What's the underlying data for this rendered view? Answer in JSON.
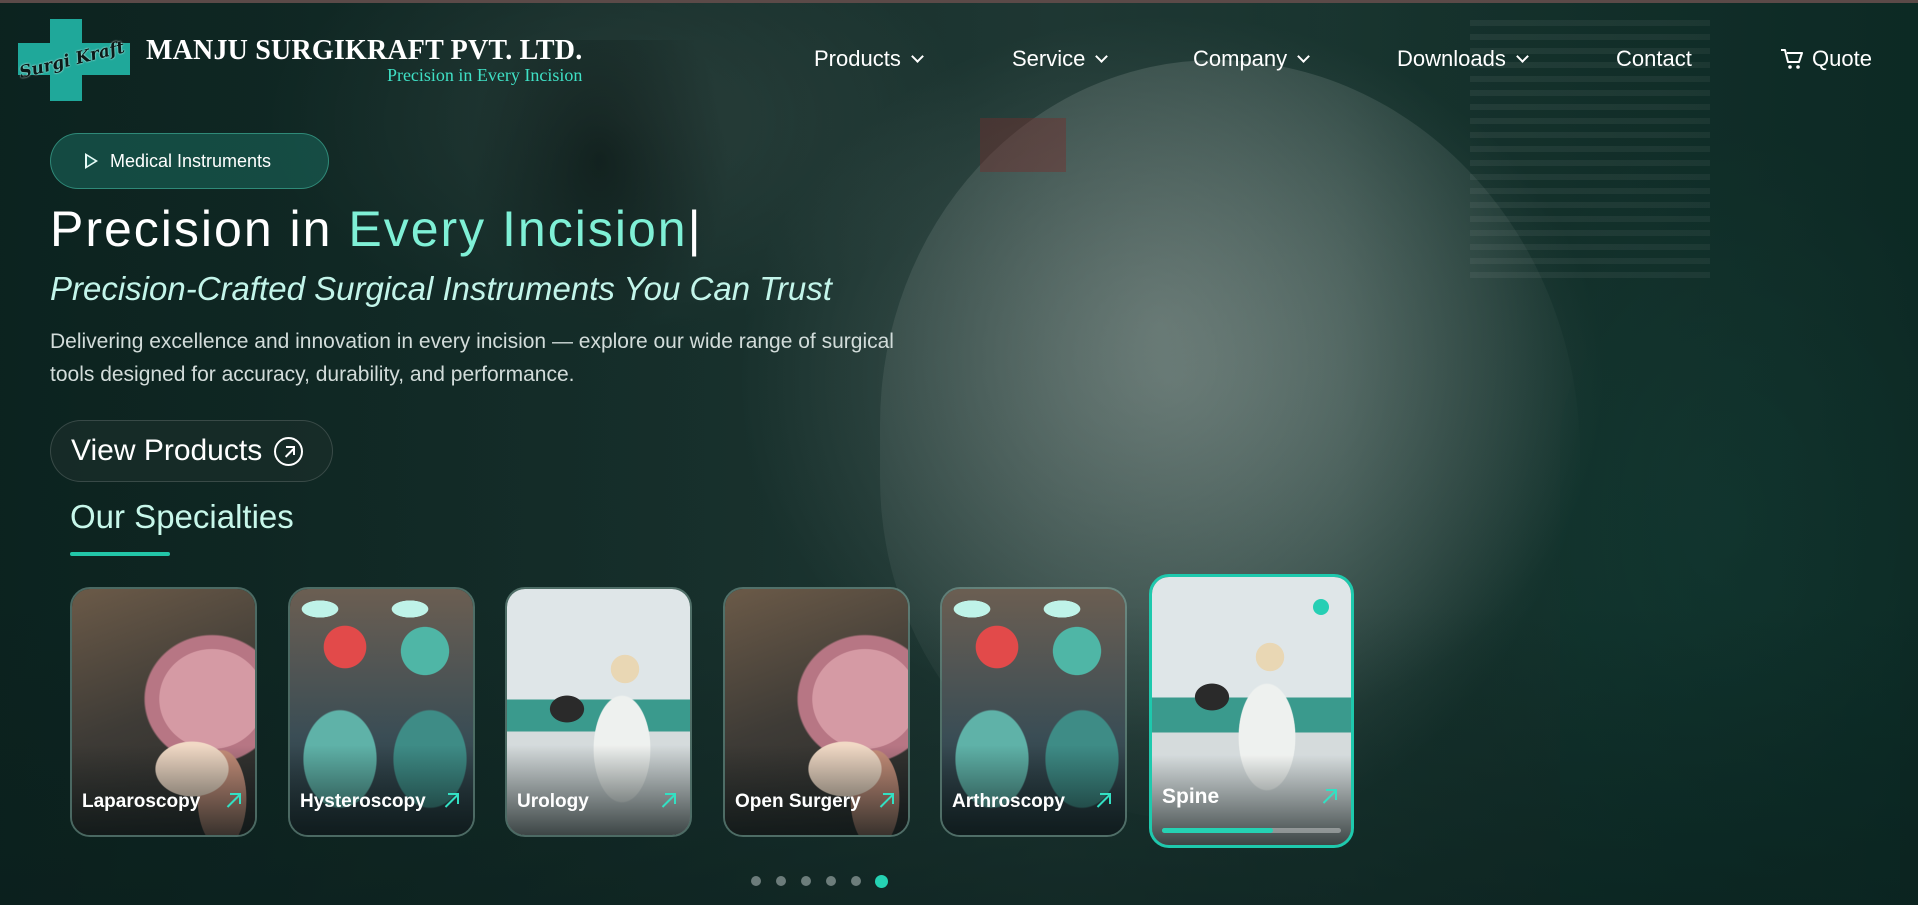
{
  "brand": {
    "logo_script": "Surgi Kraft",
    "name": "MANJU SURGIKRAFT PVT. LTD.",
    "tagline": "Precision in Every Incision"
  },
  "nav": {
    "items": [
      {
        "label": "Products",
        "has_dropdown": true
      },
      {
        "label": "Service",
        "has_dropdown": true
      },
      {
        "label": "Company",
        "has_dropdown": true
      },
      {
        "label": "Downloads",
        "has_dropdown": true
      },
      {
        "label": "Contact",
        "has_dropdown": false
      }
    ],
    "quote": {
      "label": "Quote",
      "icon": "cart-icon"
    }
  },
  "hero": {
    "pill_label": "Medical Instruments",
    "heading_plain": "Precision in ",
    "heading_highlight": "Every Incision",
    "heading_caret": "|",
    "subtitle": "Precision-Crafted Surgical Instruments You Can Trust",
    "description": "Delivering excellence and innovation in every incision — explore our wide range of surgical tools designed for accuracy, durability, and performance.",
    "cta_label": "View Products"
  },
  "specialties": {
    "title": "Our Specialties",
    "cards": [
      {
        "label": "Laparoscopy",
        "image": "brain-model"
      },
      {
        "label": "Hysteroscopy",
        "image": "surgeons"
      },
      {
        "label": "Urology",
        "image": "lab-scientist"
      },
      {
        "label": "Open Surgery",
        "image": "brain-model"
      },
      {
        "label": "Arthroscopy",
        "image": "surgeons"
      },
      {
        "label": "Spine",
        "image": "lab-scientist",
        "active": true,
        "progress": 0.62
      }
    ],
    "carousel": {
      "pages": 6,
      "active_index": 5
    }
  },
  "colors": {
    "accent": "#25d2b3",
    "highlight_text": "#7ff0d6",
    "tagline": "#3fe0c5"
  }
}
